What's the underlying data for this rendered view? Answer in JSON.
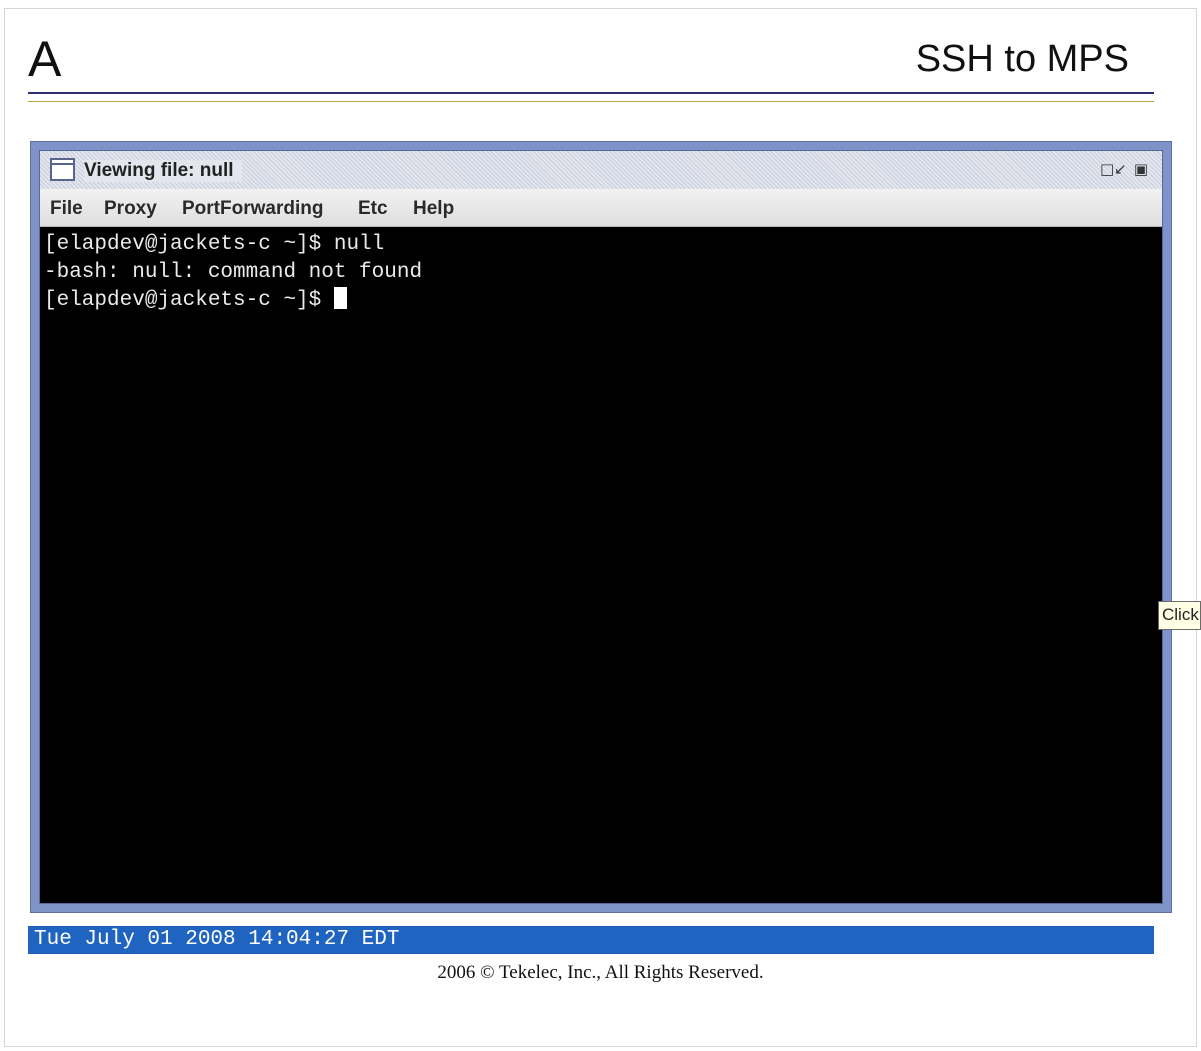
{
  "header": {
    "logo_letter": "A",
    "page_title": "SSH to MPS"
  },
  "window": {
    "title": "Viewing file: null",
    "minimize_icon": "minimize-icon",
    "maximize_icon": "maximize-icon",
    "menu": [
      "File",
      "Proxy",
      "PortForwarding",
      "Etc",
      "Help"
    ]
  },
  "terminal": {
    "lines": [
      "[elapdev@jackets-c ~]$ null",
      "-bash: null: command not found",
      "[elapdev@jackets-c ~]$ "
    ],
    "background": "#000000",
    "foreground": "#eaeaea"
  },
  "tooltip": {
    "text": "Click"
  },
  "status_bar": {
    "datetime": "Tue July 01 2008 14:04:27 EDT",
    "color": "#1e64c0"
  },
  "footer": {
    "copyright": "2006 © Tekelec, Inc., All Rights Reserved."
  }
}
